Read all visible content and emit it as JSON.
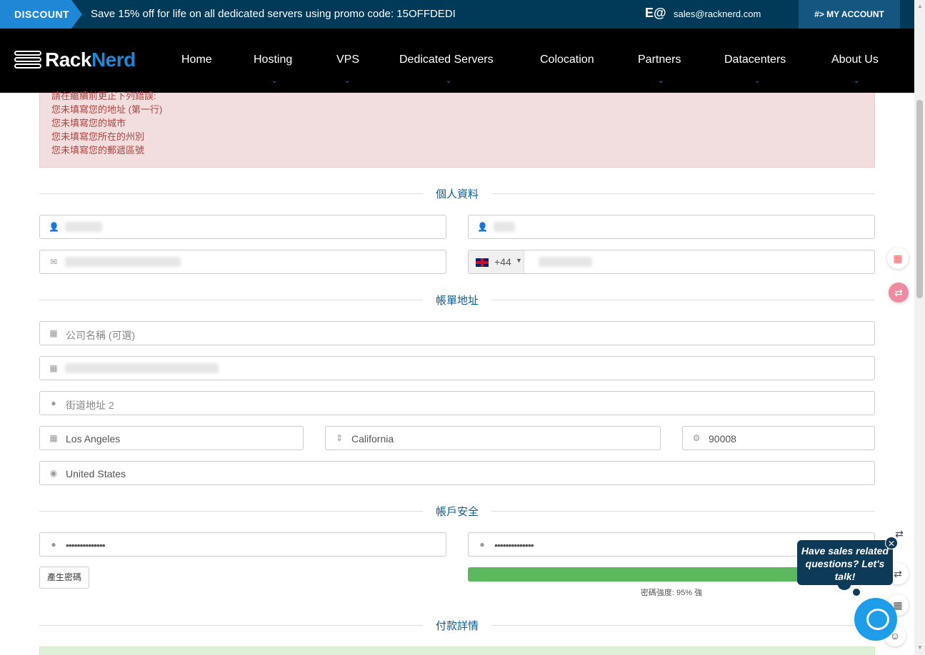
{
  "promo": {
    "tag": "DISCOUNT",
    "message": "Save 15% off for life on all dedicated servers using promo code: 15OFFDEDI",
    "mail_icon": "E@",
    "email": "sales@racknerd.com",
    "account": "#> MY ACCOUNT"
  },
  "nav": {
    "brand_a": "Rack",
    "brand_b": "Nerd",
    "items": [
      "Home",
      "Hosting",
      "VPS",
      "Dedicated Servers",
      "Colocation",
      "Partners",
      "Datacenters",
      "About Us"
    ],
    "chevron": "⌄"
  },
  "errors": {
    "heading": "請在繼續前更正下列錯誤:",
    "items": [
      "您未填寫您的地址 (第一行)",
      "您未填寫您的城市",
      "您未填寫您所在的州別",
      "您未填寫您的郵遞區號"
    ]
  },
  "sections": {
    "personal": "個人資料",
    "billing": "帳單地址",
    "security": "帳戶安全",
    "payment": "付款詳情"
  },
  "form": {
    "phone_code": "+44",
    "company_placeholder": "公司名稱 (可選)",
    "street2_placeholder": "街道地址 2",
    "city": "Los Angeles",
    "state": "California",
    "zip": "90008",
    "country": "United States",
    "password_mask": "••••••••••••••",
    "confirm_mask": "••••••••••••••",
    "generate_btn": "產生密碼",
    "strength_label": "密碼強度: 95% 強",
    "strength_percent": 95
  },
  "chat": {
    "bubble": "Have sales related questions? Let's talk!",
    "close": "✕"
  },
  "colors": {
    "promo_bg": "#003a59",
    "accent": "#1e88d7",
    "error_bg": "#f2dede",
    "section_title": "#0d5d8d",
    "strength": "#5cb85c"
  }
}
